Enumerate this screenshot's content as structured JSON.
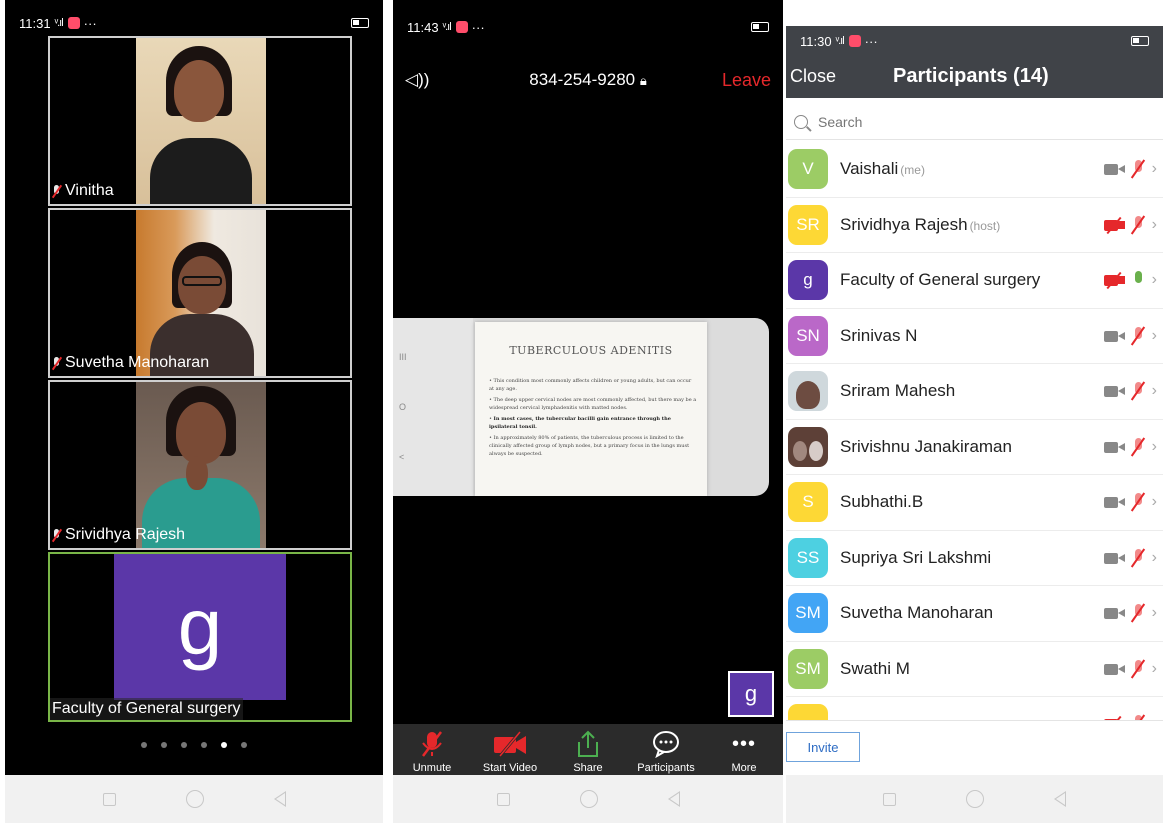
{
  "phone1": {
    "status": {
      "time": "11:31",
      "signal": "ᵛ.ıl",
      "dots": "···"
    },
    "tiles": [
      {
        "name": "Vinitha"
      },
      {
        "name": "Suvetha Manoharan"
      },
      {
        "name": "Srividhya Rajesh"
      },
      {
        "name": "Faculty of General surgery",
        "initial": "g"
      }
    ],
    "pager": {
      "count": 6,
      "active_index": 4
    }
  },
  "phone2": {
    "status": {
      "time": "11:43",
      "signal": "ᵛ.ıl",
      "dots": "···"
    },
    "speaker_icon": "◁))",
    "meeting_id": "834-254-9280",
    "leave_label": "Leave",
    "slide": {
      "title": "TUBERCULOUS ADENITIS",
      "bullets": [
        "This condition most commonly affects children or young adults, but can occur at any age.",
        "The deep upper cervical nodes are most commonly affected, but there may be a widespread cervical lymphadenitis with matted nodes.",
        "In most cases, the tubercular bacilli gain entrance through the ipsilateral tonsil.",
        "In approximately 80% of patients, the tuberculous process is limited to the clinically affected group of lymph nodes, but a primary focus in the lungs must always be suspected."
      ]
    },
    "side_controls": [
      "III",
      "O",
      "<"
    ],
    "self_initial": "g",
    "toolbar": {
      "unmute": "Unmute",
      "start_video": "Start Video",
      "share": "Share",
      "participants": "Participants",
      "more": "More"
    }
  },
  "phone3": {
    "status": {
      "time": "11:30",
      "signal": "ᵛ.ıl",
      "dots": "···"
    },
    "close_label": "Close",
    "title": "Participants (14)",
    "search_placeholder": "Search",
    "participants": [
      {
        "name": "Vaishali",
        "tag": "(me)",
        "initials": "V",
        "color": "#9ccc65",
        "cam": "on",
        "mic": "off"
      },
      {
        "name": "Srividhya Rajesh",
        "tag": "(host)",
        "initials": "SR",
        "color": "#fdd835",
        "cam": "off",
        "mic": "off"
      },
      {
        "name": "Faculty of General surgery",
        "tag": "",
        "initials": "g",
        "color": "#5b37a8",
        "cam": "off",
        "mic": "on"
      },
      {
        "name": "Srinivas N",
        "tag": "",
        "initials": "SN",
        "color": "#ba68c8",
        "cam": "on",
        "mic": "off"
      },
      {
        "name": "Sriram Mahesh",
        "tag": "",
        "initials": "",
        "color": "#cfd8dc",
        "cam": "on",
        "mic": "off"
      },
      {
        "name": "Srivishnu Janakiraman",
        "tag": "",
        "initials": "",
        "color": "#5d4037",
        "cam": "on",
        "mic": "off"
      },
      {
        "name": "Subhathi.B",
        "tag": "",
        "initials": "S",
        "color": "#fdd835",
        "cam": "on",
        "mic": "off"
      },
      {
        "name": "Supriya Sri Lakshmi",
        "tag": "",
        "initials": "SS",
        "color": "#4dd0e1",
        "cam": "on",
        "mic": "off"
      },
      {
        "name": "Suvetha Manoharan",
        "tag": "",
        "initials": "SM",
        "color": "#42a5f5",
        "cam": "on",
        "mic": "off"
      },
      {
        "name": "Swathi M",
        "tag": "",
        "initials": "SM",
        "color": "#9ccc65",
        "cam": "on",
        "mic": "off"
      },
      {
        "name": "",
        "tag": "",
        "initials": "",
        "color": "#fdd835",
        "cam": "off",
        "mic": "off"
      }
    ],
    "invite_label": "Invite"
  }
}
